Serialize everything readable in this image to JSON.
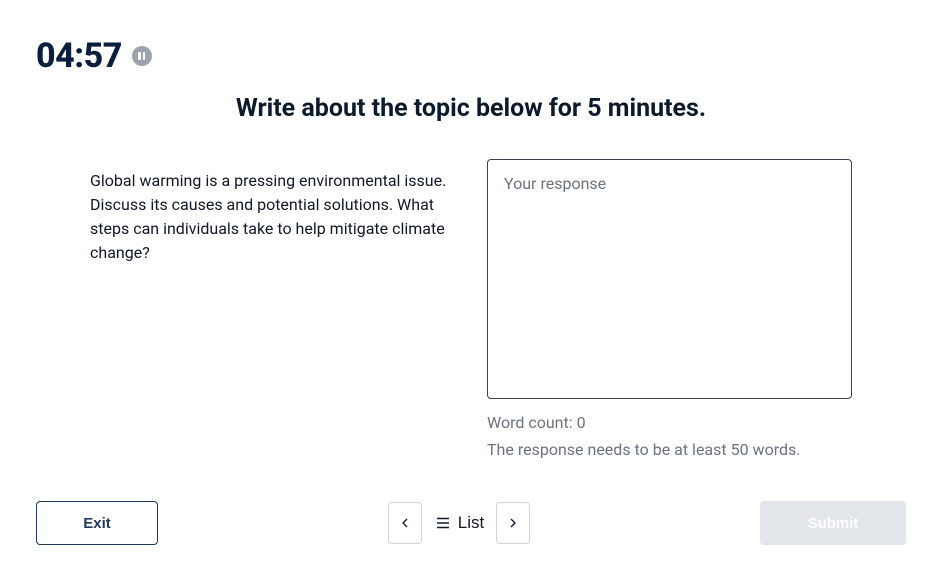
{
  "timer": {
    "value": "04:57"
  },
  "heading": "Write about the topic below for 5 minutes.",
  "prompt": "Global warming is a pressing environmental issue. Discuss its causes and potential solutions. What steps can individuals take to help mitigate climate change?",
  "response": {
    "placeholder": "Your response",
    "value": ""
  },
  "wordCount": "Word count: 0",
  "minWords": "The response needs to be at least 50 words.",
  "footer": {
    "exit": "Exit",
    "list": "List",
    "submit": "Submit"
  }
}
